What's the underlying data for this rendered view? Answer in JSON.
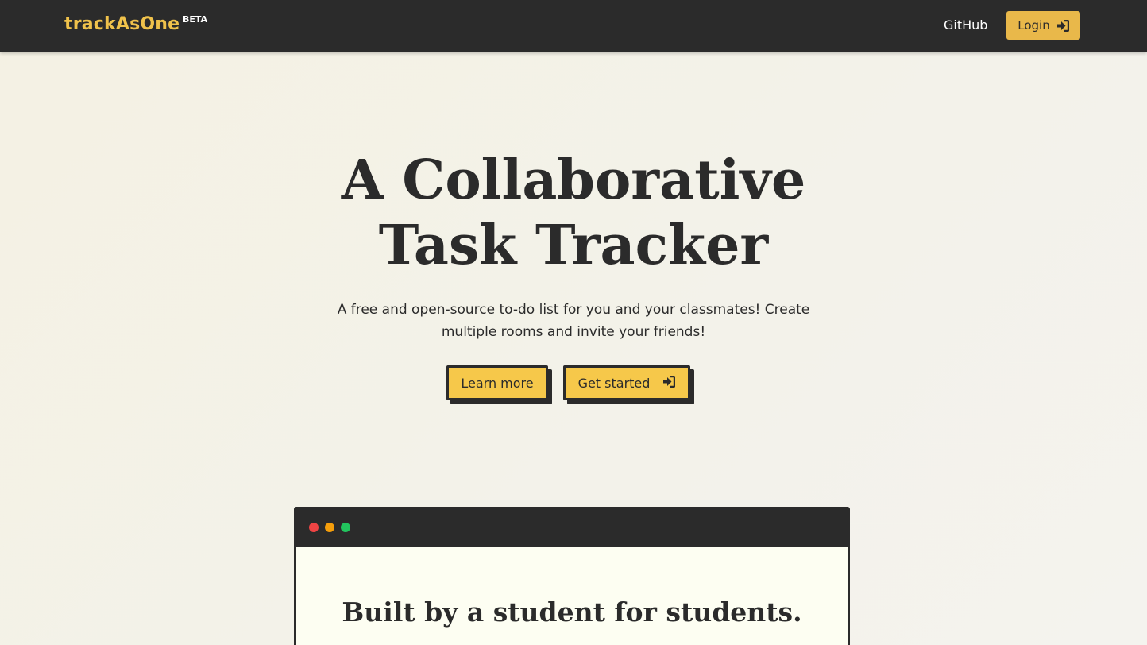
{
  "navbar": {
    "brand": "trackAsOne",
    "badge": "BETA",
    "github_label": "GitHub",
    "login_label": "Login",
    "login_icon": "sign-in-icon"
  },
  "hero": {
    "title_line1": "A Collaborative",
    "title_line2": "Task Tracker",
    "subtitle_line1": "A free and open-source to-do list for you and your classmates! Create",
    "subtitle_line2": "multiple rooms and invite your friends!",
    "learn_more_label": "Learn more",
    "get_started_label": "Get started",
    "get_started_icon": "sign-in-icon"
  },
  "preview_window": {
    "heading": "Built by a student for students."
  },
  "colors": {
    "brand": "#f0c24b",
    "navbar_bg": "#2b2b2b",
    "button_bg": "#f6c84a",
    "login_bg": "#e9b84a",
    "dot_red": "#ef4444",
    "dot_yellow": "#f59e0b",
    "dot_green": "#22c55e"
  }
}
